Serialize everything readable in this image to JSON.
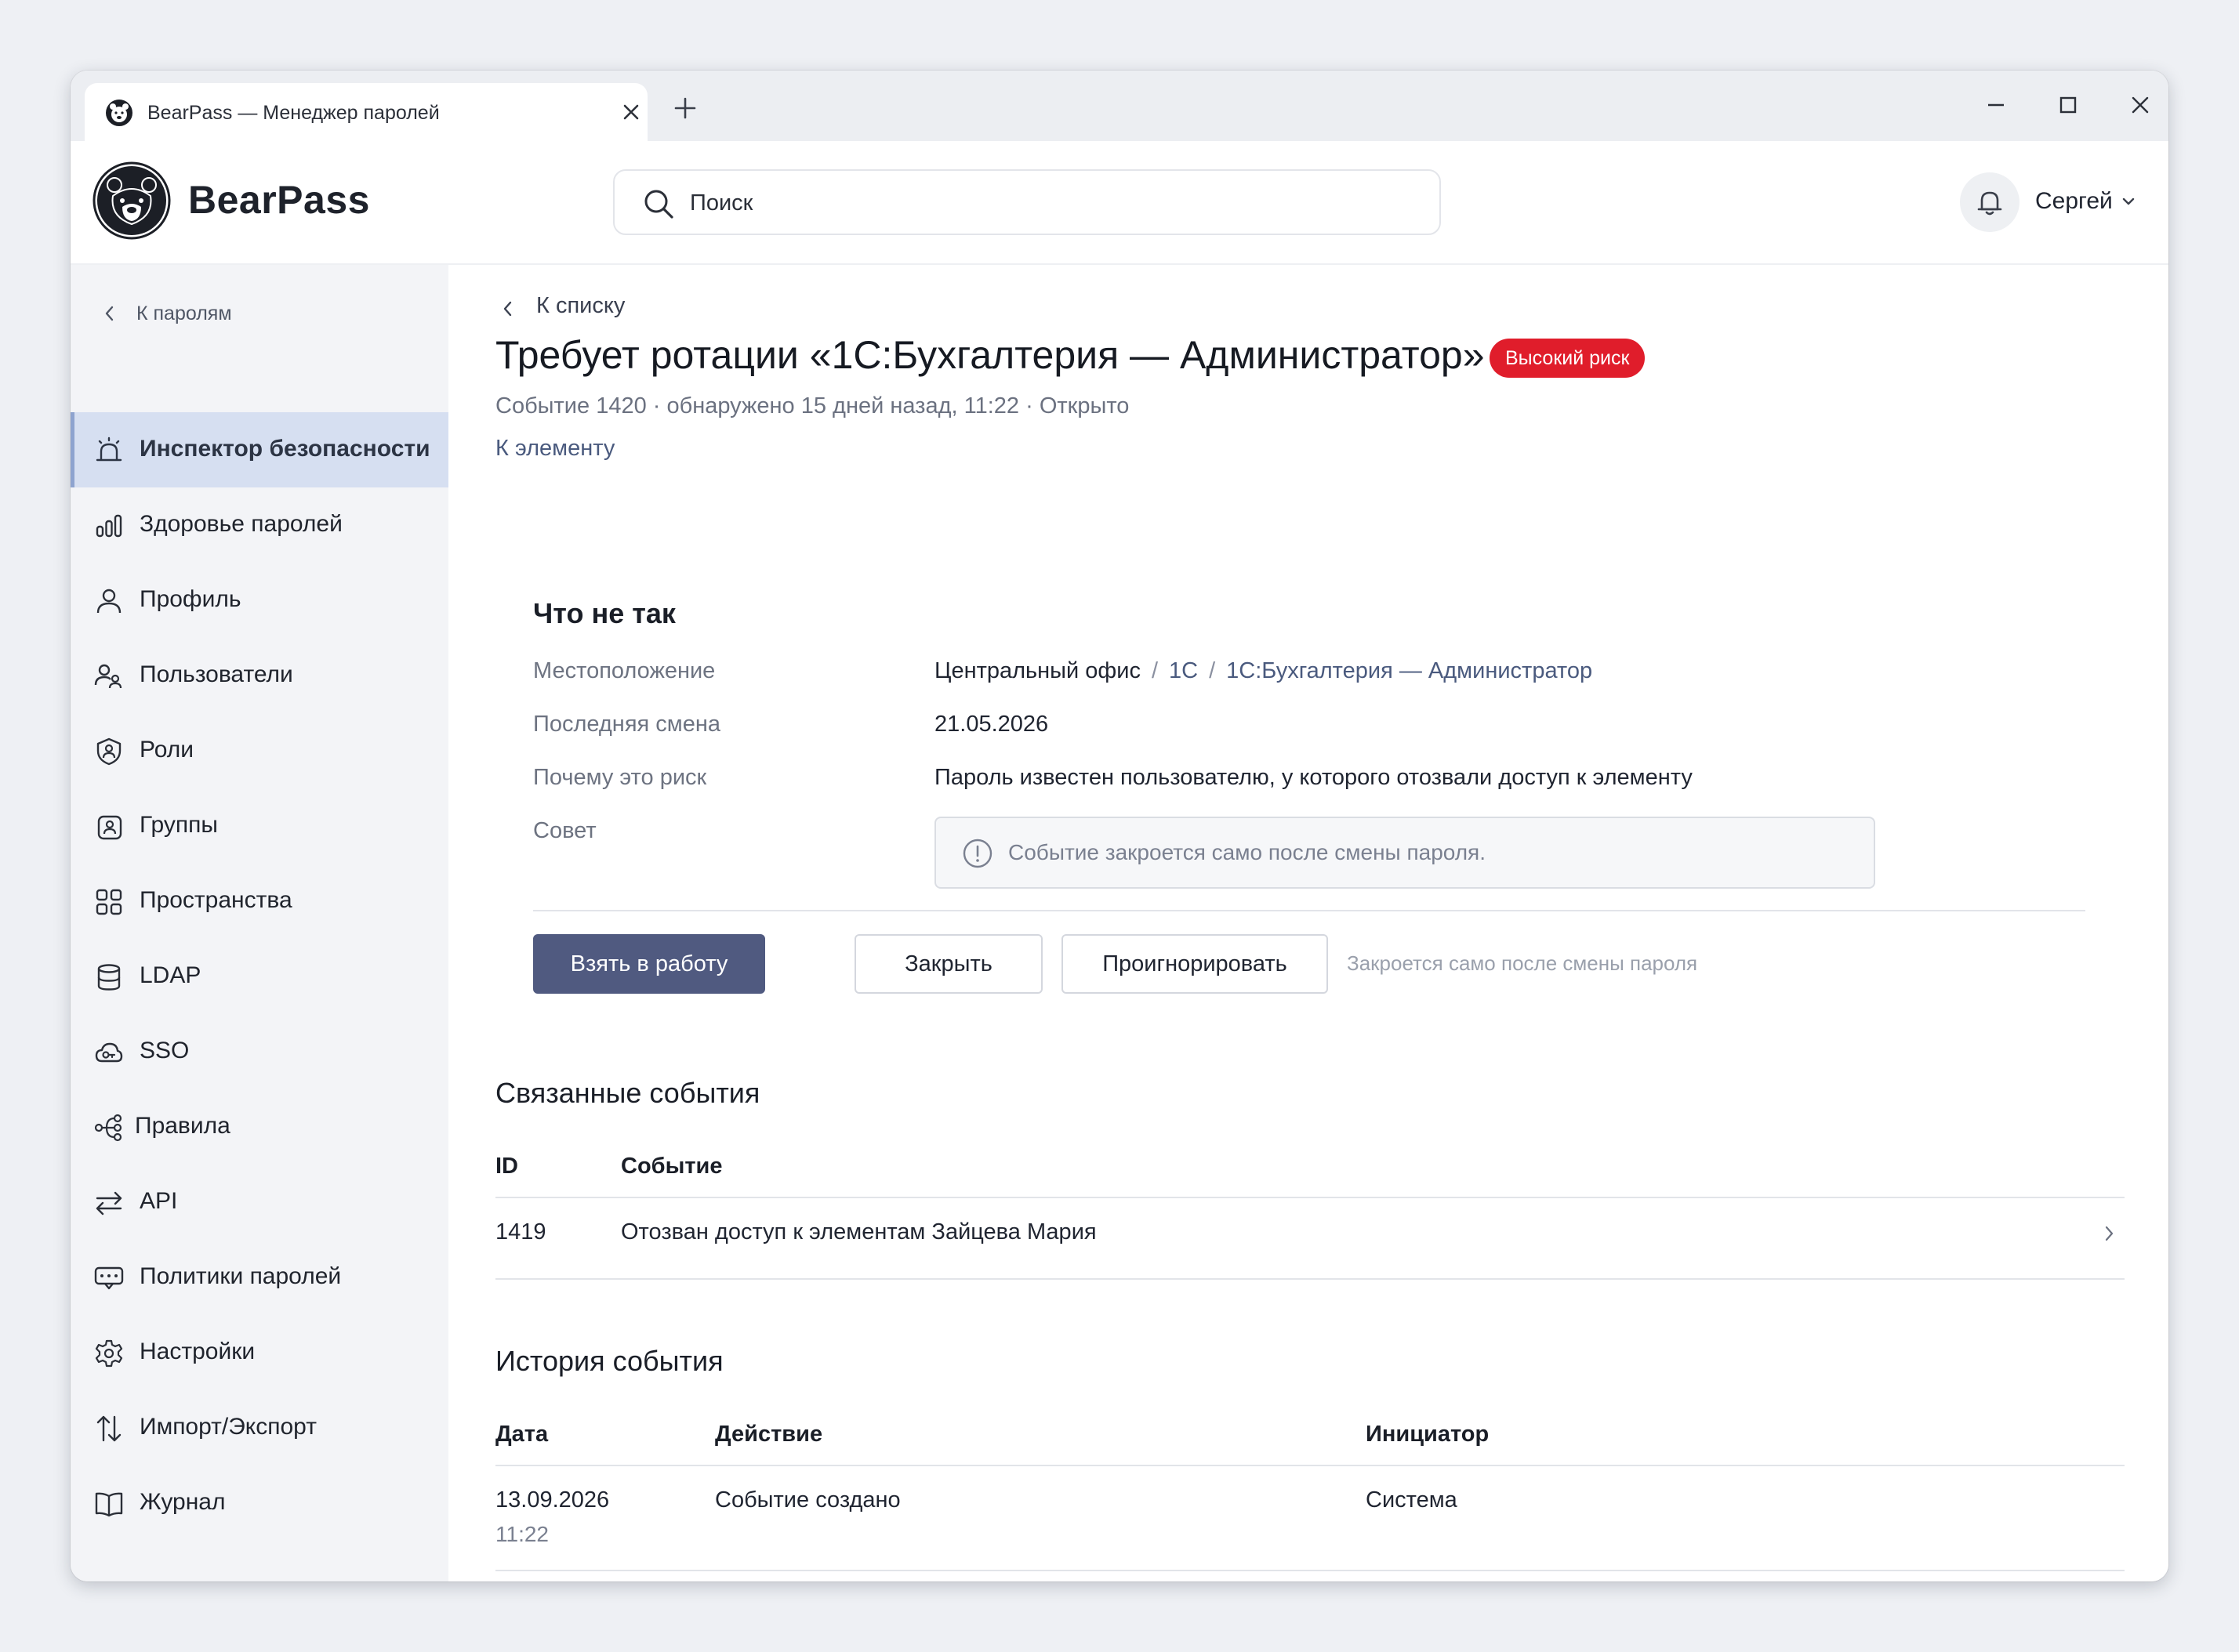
{
  "window": {
    "tab_title": "BearPass — Менеджер паролей"
  },
  "header": {
    "brand": "BearPass",
    "search_placeholder": "Поиск",
    "user_name": "Сергей"
  },
  "sidebar": {
    "back_label": "К паролям",
    "items": [
      {
        "label": "Инспектор безопасности",
        "icon": "alarm-icon",
        "active": true
      },
      {
        "label": "Здоровье паролей",
        "icon": "bar-chart-icon"
      },
      {
        "label": "Профиль",
        "icon": "user-icon"
      },
      {
        "label": "Пользователи",
        "icon": "users-icon"
      },
      {
        "label": "Роли",
        "icon": "shield-user-icon"
      },
      {
        "label": "Группы",
        "icon": "group-icon"
      },
      {
        "label": "Пространства",
        "icon": "grid-icon"
      },
      {
        "label": "LDAP",
        "icon": "database-icon"
      },
      {
        "label": "SSO",
        "icon": "cloud-key-icon"
      },
      {
        "label": "Правила",
        "icon": "flow-icon"
      },
      {
        "label": "API",
        "icon": "arrows-exchange-icon"
      },
      {
        "label": "Политики паролей",
        "icon": "password-policy-icon"
      },
      {
        "label": "Настройки",
        "icon": "gear-icon"
      },
      {
        "label": "Импорт/Экспорт",
        "icon": "import-export-icon"
      },
      {
        "label": "Журнал",
        "icon": "book-icon"
      }
    ]
  },
  "main": {
    "back_label": "К списку",
    "title": "Требует ротации «1С:Бухгалтерия — Администратор»",
    "badge": "Высокий риск",
    "meta": "Событие 1420 · обнаружено 15 дней назад, 11:22 · Открыто",
    "to_element": "К элементу",
    "issue": {
      "heading": "Что не так",
      "location_label": "Местоположение",
      "location_path": [
        "Центральный офис",
        "1С",
        "1С:Бухгалтерия — Администратор"
      ],
      "last_change_label": "Последняя смена",
      "last_change_value": "21.05.2026",
      "why_label": "Почему это риск",
      "why_value": "Пароль известен пользователю, у которого отозвали доступ к элементу",
      "advice_label": "Совет",
      "advice_text": "Событие закроется само после смены пароля."
    },
    "actions": {
      "take": "Взять в работу",
      "close": "Закрыть",
      "ignore": "Проигнорировать",
      "hint": "Закроется само после смены пароля"
    },
    "related": {
      "heading": "Связанные события",
      "columns": [
        "ID",
        "Событие"
      ],
      "rows": [
        {
          "id": "1419",
          "event": "Отозван доступ к элементам Зайцева Мария"
        }
      ]
    },
    "history": {
      "heading": "История события",
      "columns": [
        "Дата",
        "Действие",
        "Инициатор"
      ],
      "rows": [
        {
          "date": "13.09.2026",
          "time": "11:22",
          "action": "Событие создано",
          "initiator": "Система"
        }
      ]
    }
  },
  "colors": {
    "accent": "#505a80",
    "badge": "#e01d2b",
    "active_nav": "#d6dff1",
    "link": "#4a5a7e"
  }
}
